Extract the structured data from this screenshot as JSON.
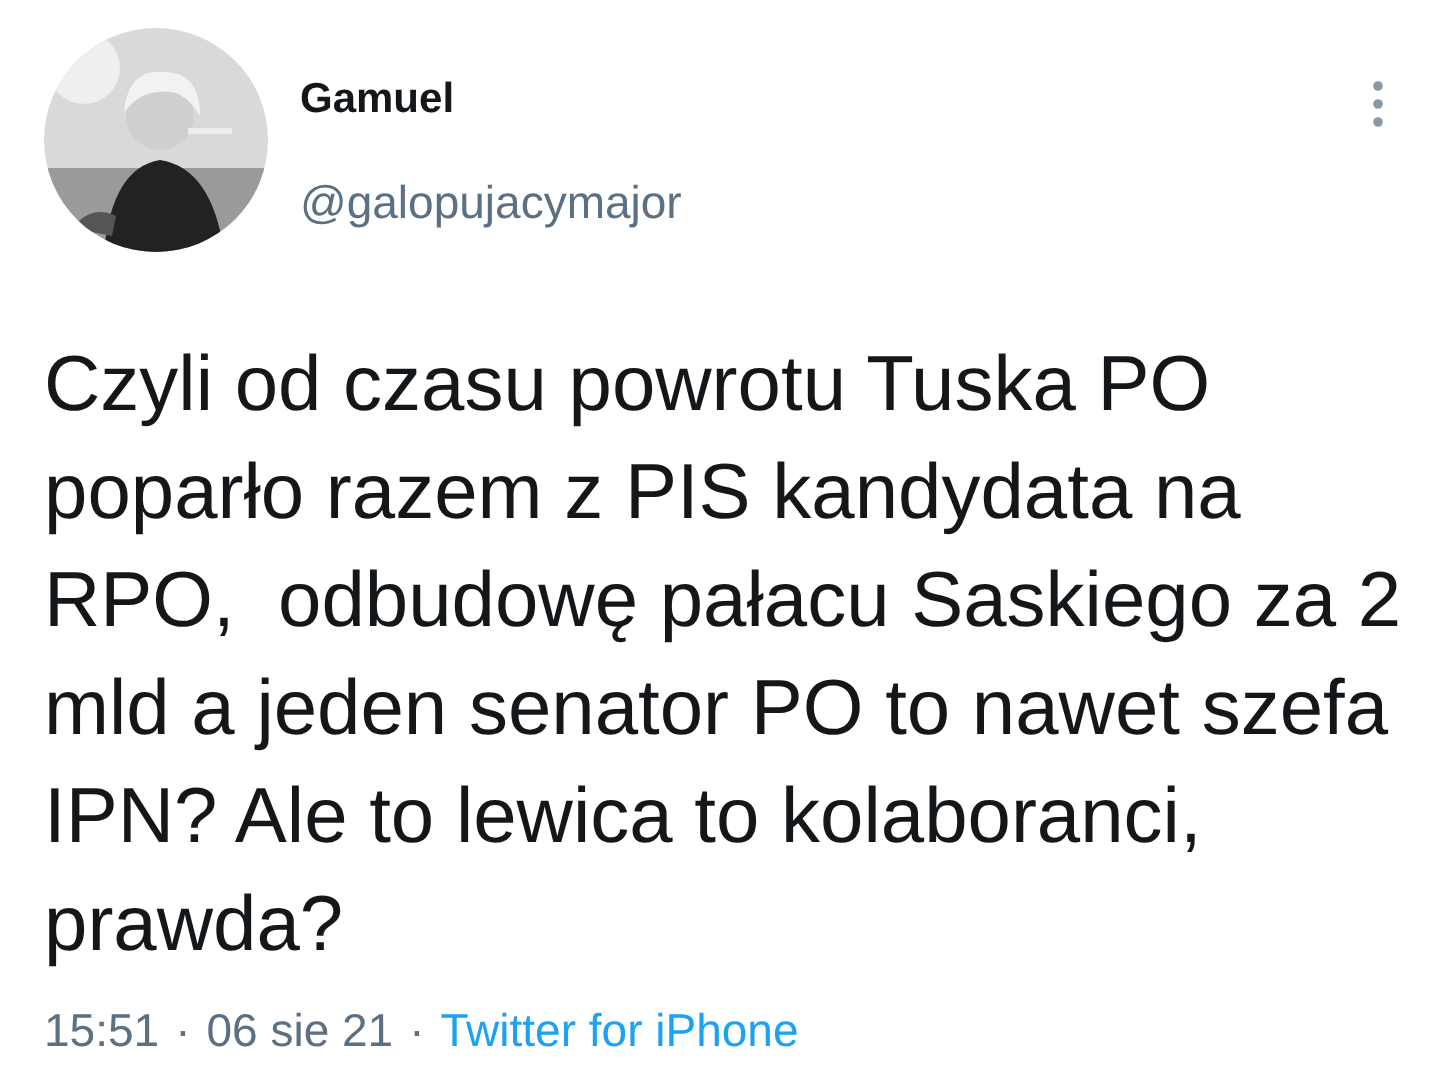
{
  "author": {
    "name": "Gamuel",
    "handle": "@galopujacymajor"
  },
  "tweet": {
    "text": "Czyli od czasu powrotu Tuska PO poparło razem z PIS kandydata na RPO,  odbudowę pałacu Saskiego za 2 mld a jeden senator PO to nawet szefa IPN? Ale to lewica to kolaboranci, prawda?"
  },
  "footer": [
    {
      "kind": "time",
      "text": "15:51"
    },
    {
      "kind": "sep",
      "text": "·"
    },
    {
      "kind": "date",
      "text": "06 sie 21"
    },
    {
      "kind": "sep",
      "text": "·"
    },
    {
      "kind": "source",
      "text": "Twitter for iPhone"
    }
  ]
}
